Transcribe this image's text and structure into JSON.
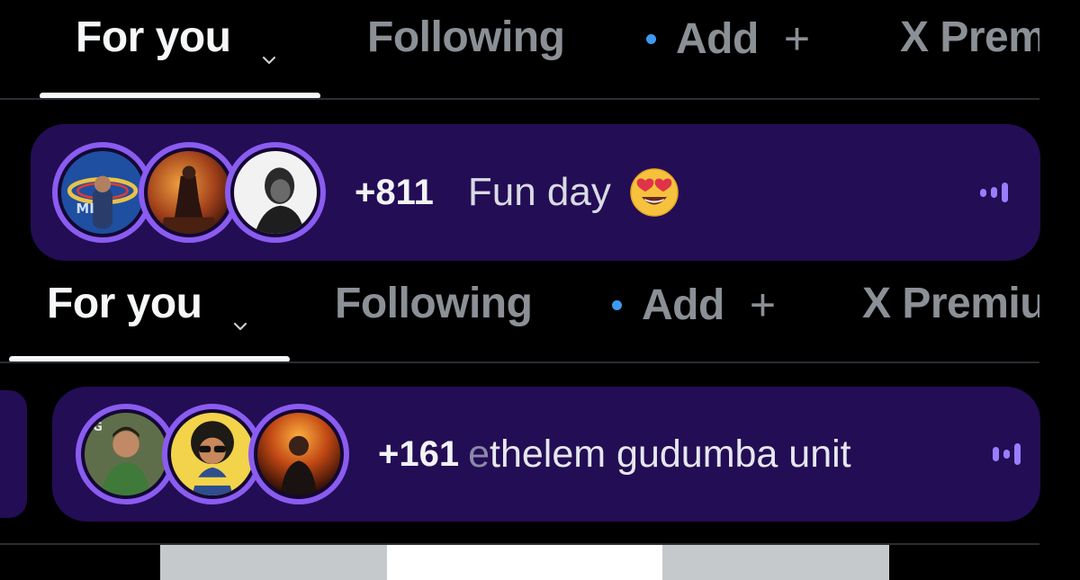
{
  "tabs_top": {
    "for_you": "For you",
    "following": "Following",
    "add": "Add",
    "add_symbol": "+",
    "premium": "X Premium"
  },
  "space_top": {
    "listener_count": "+811",
    "title": "Fun day",
    "emoji": "smiling-face-with-heart-eyes",
    "avatars": [
      "avatar-mumbai-indians-logo",
      "avatar-warrior-fire",
      "avatar-bw-portrait"
    ]
  },
  "tabs_bottom": {
    "for_you": "For you",
    "following": "Following",
    "add": "Add",
    "add_symbol": "+",
    "premium": "X Premium"
  },
  "space_bottom": {
    "listener_count": "+161",
    "title_faded": "e",
    "title": "thelem gudumba unit",
    "avatars": [
      "avatar-man-green-shirt",
      "avatar-cartoon-sunglasses",
      "avatar-fire-portrait"
    ]
  },
  "colors": {
    "background": "#000000",
    "space_card": "#230d55",
    "avatar_ring": "#8a5cf0",
    "unread_dot": "#3d9af0",
    "live_bars": "#9a7dff"
  }
}
